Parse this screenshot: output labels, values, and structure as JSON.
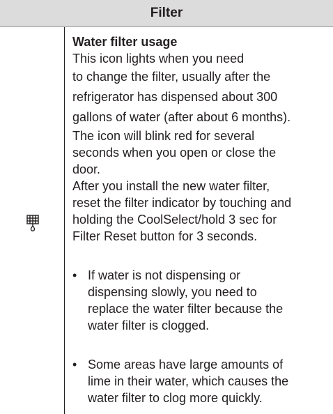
{
  "header": {
    "title": "Filter"
  },
  "icon": {
    "name": "water-filter-icon"
  },
  "section": {
    "title": "Water filter usage",
    "lines": [
      "This icon lights when you need",
      "to change the filter, usually after the",
      "refrigerator has dispensed about 300",
      "gallons of water (after about 6 months).",
      "The icon will blink red for several",
      "seconds when you open or close the",
      "door.",
      "After you install the new water filter,",
      "reset the filter indicator by touching and",
      "holding the CoolSelect/hold 3 sec for",
      "Filter Reset button for 3 seconds."
    ],
    "bullets": [
      {
        "lines": [
          "If water is not dispensing or",
          "dispensing slowly, you need to",
          "replace the water filter because the",
          "water filter is clogged."
        ]
      },
      {
        "lines": [
          "Some areas have large amounts of",
          "lime in their water, which causes the",
          "water filter to clog more quickly."
        ]
      }
    ]
  }
}
